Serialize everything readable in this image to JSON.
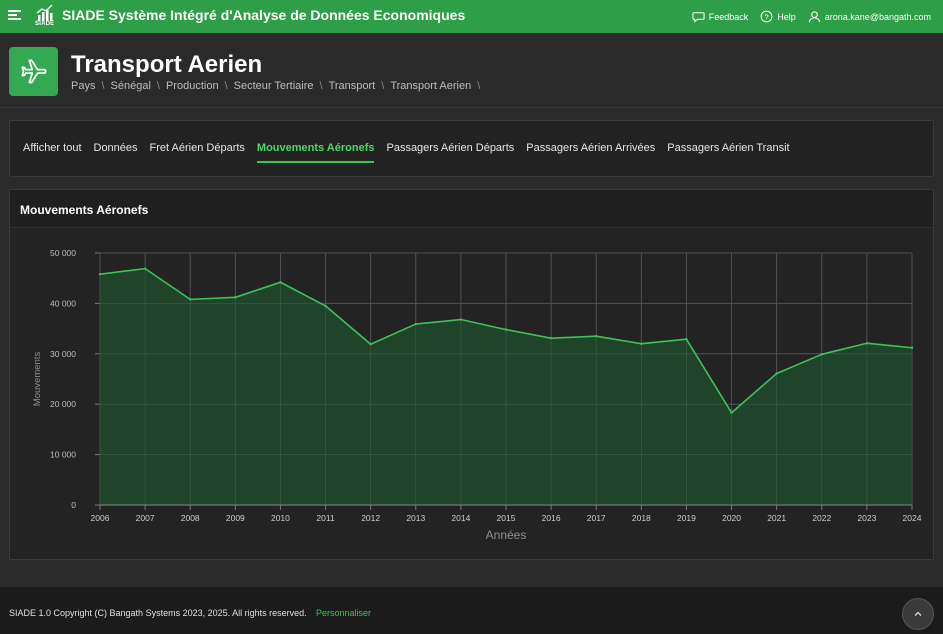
{
  "app": {
    "logo_text": "SIADE",
    "title": "SIADE Système Intégré d'Analyse de Données Economiques"
  },
  "topbar": {
    "feedback_label": "Feedback",
    "help_label": "Help",
    "user_email": "arona.kane@bangath.com"
  },
  "header": {
    "title": "Transport Aerien",
    "icon": "airplane-icon",
    "breadcrumb": [
      "Pays",
      "Sénégal",
      "Production",
      "Secteur Tertiaire",
      "Transport",
      "Transport Aerien"
    ],
    "separator": "\\"
  },
  "tabs": [
    {
      "label": "Afficher tout",
      "active": false
    },
    {
      "label": "Données",
      "active": false
    },
    {
      "label": "Fret Aérien Départs",
      "active": false
    },
    {
      "label": "Mouvements Aéronefs",
      "active": true
    },
    {
      "label": "Passagers Aérien Départs",
      "active": false
    },
    {
      "label": "Passagers Aérien Arrivées",
      "active": false
    },
    {
      "label": "Passagers Aérien Transit",
      "active": false
    }
  ],
  "chart_panel": {
    "title": "Mouvements Aéronefs"
  },
  "colors": {
    "accent": "#2e9e48",
    "line": "#3ec15b",
    "area": "#1f4a2a"
  },
  "chart_data": {
    "type": "area",
    "x": [
      "2006",
      "2007",
      "2008",
      "2009",
      "2010",
      "2011",
      "2012",
      "2013",
      "2014",
      "2015",
      "2016",
      "2017",
      "2018",
      "2019",
      "2020",
      "2021",
      "2022",
      "2023",
      "2024"
    ],
    "series": [
      {
        "values": [
          45800,
          46900,
          40800,
          41200,
          44200,
          39500,
          31900,
          35900,
          36800,
          34800,
          33100,
          33500,
          32000,
          32900,
          18300,
          26100,
          29900,
          32100,
          31200
        ]
      }
    ],
    "xlabel": "Années",
    "ylabel": "Mouvements",
    "ylim": [
      0,
      50000
    ],
    "yticks": [
      0,
      10000,
      20000,
      30000,
      40000,
      50000
    ],
    "ytick_labels": [
      "0",
      "10 000",
      "20 000",
      "30 000",
      "40 000",
      "50 000"
    ],
    "grid": true
  },
  "footer": {
    "copyright": "SIADE 1.0 Copyright (C) Bangath Systems 2023, 2025. All rights reserved.",
    "customize_label": "Personnaliser"
  }
}
